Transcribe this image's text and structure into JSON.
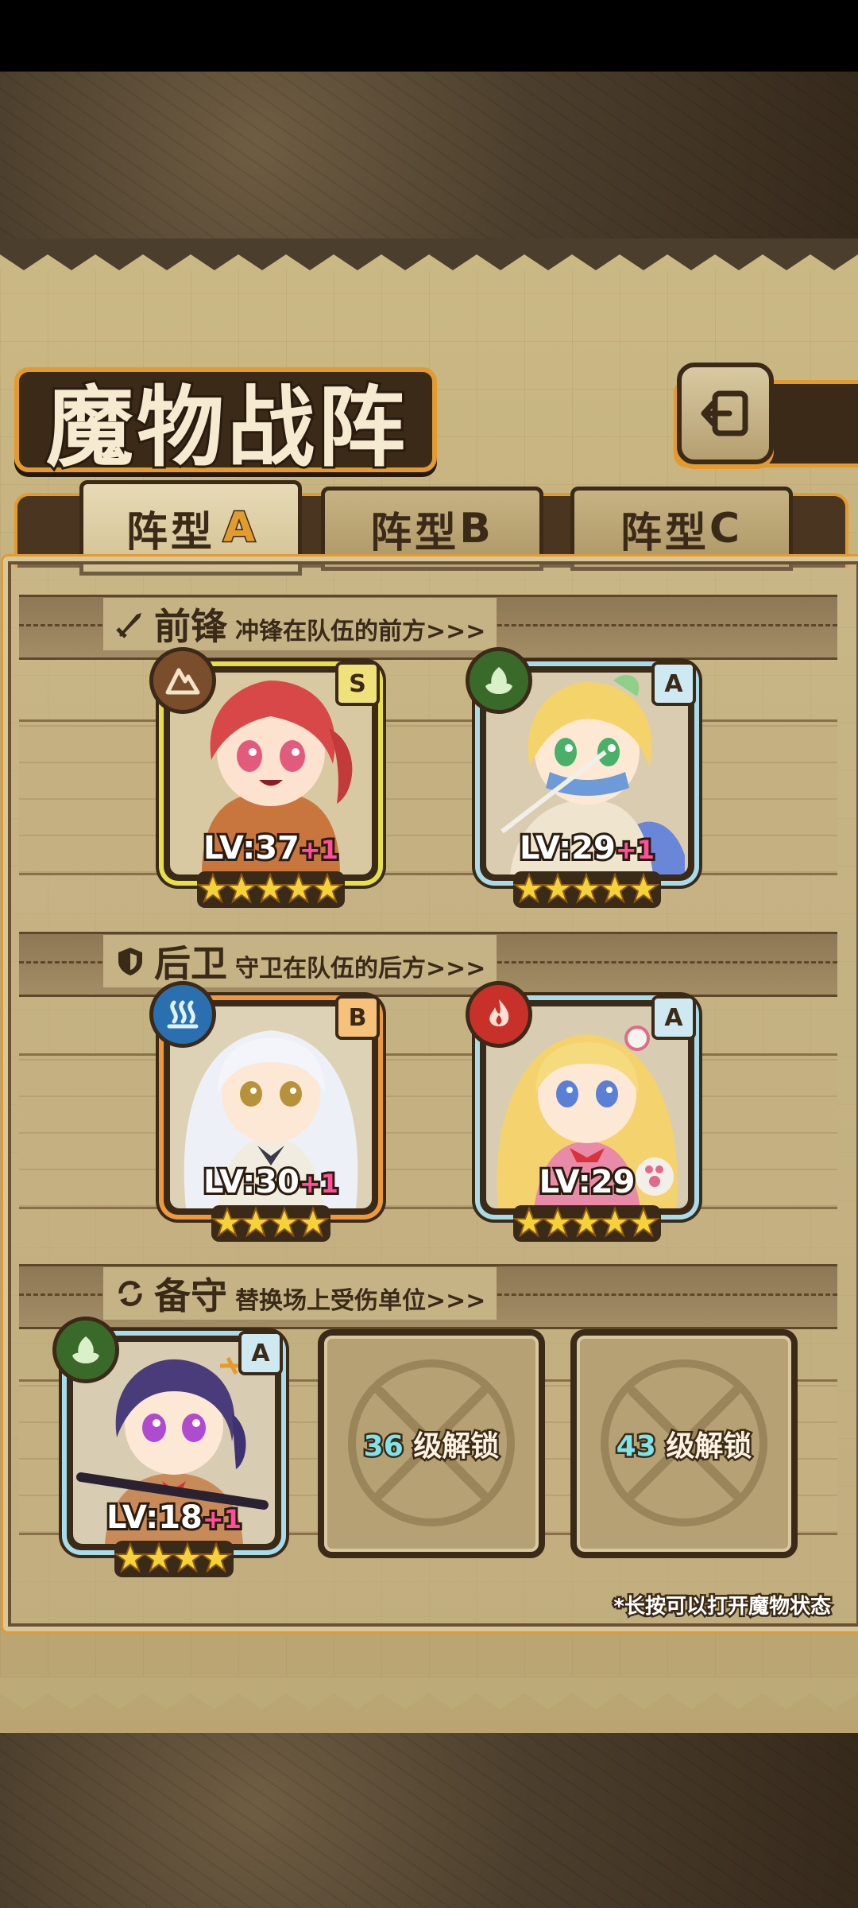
{
  "screen": {
    "title": "魔物战阵",
    "back_icon": "return-arrow-icon"
  },
  "tabs": [
    {
      "label": "阵型",
      "suffix": "A",
      "active": true
    },
    {
      "label": "阵型",
      "suffix": "B",
      "active": false
    },
    {
      "label": "阵型",
      "suffix": "C",
      "active": false
    }
  ],
  "sections": {
    "front": {
      "name": "前锋",
      "desc": "冲锋在队伍的前方>>>",
      "icon": "sword-icon"
    },
    "rear": {
      "name": "后卫",
      "desc": "守卫在队伍的后方>>>",
      "icon": "shield-icon"
    },
    "reserve": {
      "name": "备守",
      "desc": "替换场上受伤单位>>>",
      "icon": "swap-icon"
    }
  },
  "units": {
    "front_1": {
      "rank": "S",
      "element": "earth",
      "lv_prefix": "LV:",
      "level": "37",
      "bonus": "+1",
      "stars": 5,
      "frame_color": "#e8e048",
      "elem_color": "#7a4d2c"
    },
    "front_2": {
      "rank": "A",
      "element": "wind",
      "lv_prefix": "LV:",
      "level": "29",
      "bonus": "+1",
      "stars": 5,
      "frame_color": "#a8dcea",
      "elem_color": "#3a6a2a"
    },
    "rear_1": {
      "rank": "B",
      "element": "water",
      "lv_prefix": "LV:",
      "level": "30",
      "bonus": "+1",
      "stars": 4,
      "frame_color": "#ef9a3a",
      "elem_color": "#2a6fb0"
    },
    "rear_2": {
      "rank": "A",
      "element": "fire",
      "lv_prefix": "LV:",
      "level": "29",
      "bonus": "",
      "stars": 5,
      "frame_color": "#a8dcea",
      "elem_color": "#c8302a"
    },
    "reserve_1": {
      "rank": "A",
      "element": "wind",
      "lv_prefix": "LV:",
      "level": "18",
      "bonus": "+1",
      "stars": 4,
      "frame_color": "#a8dcea",
      "elem_color": "#3a6a2a"
    }
  },
  "locked_slots": [
    {
      "level": "36",
      "text": "级解锁"
    },
    {
      "level": "43",
      "text": "级解锁"
    }
  ],
  "footer": {
    "note": "*长按可以打开魔物状态"
  }
}
